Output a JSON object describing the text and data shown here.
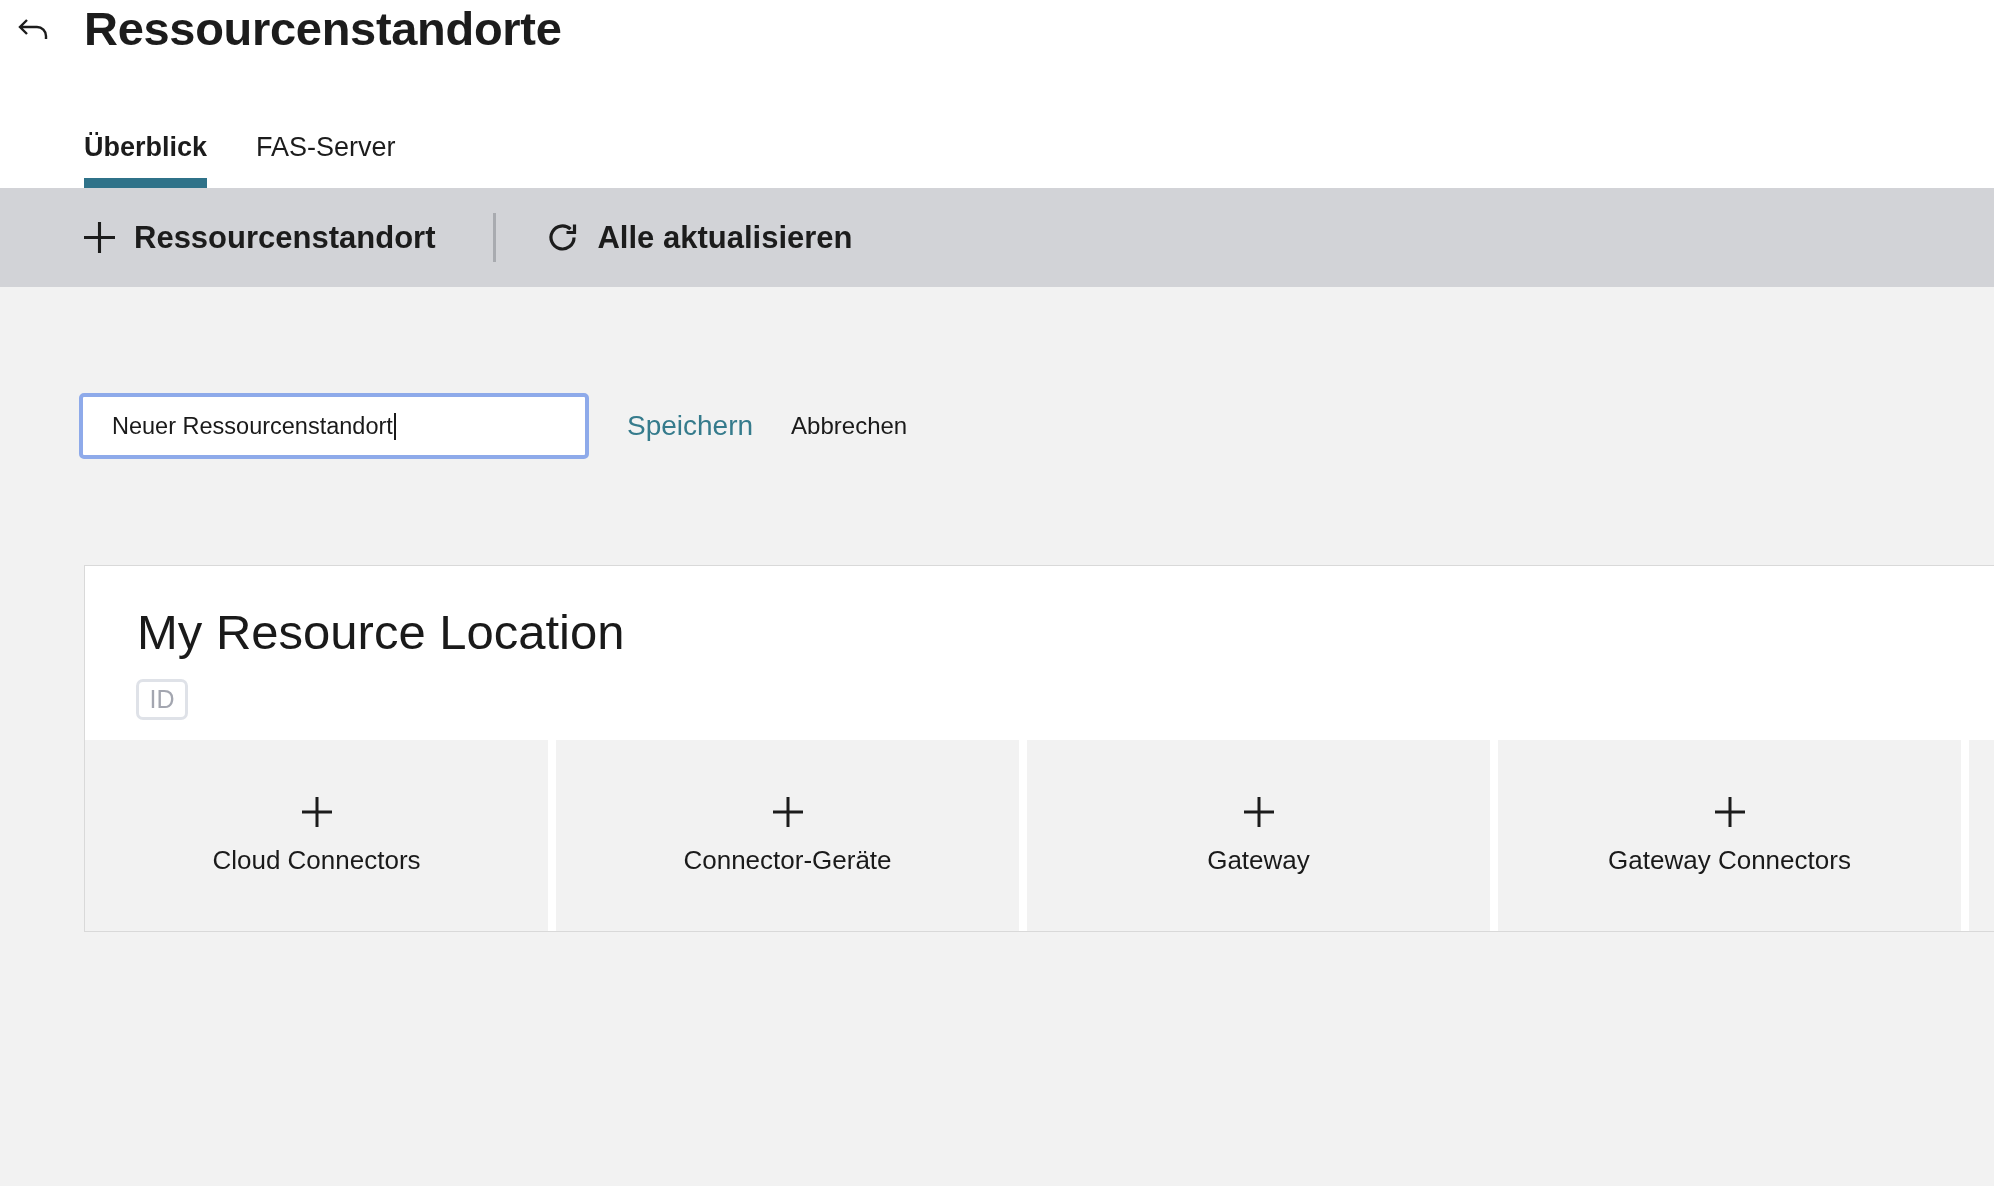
{
  "header": {
    "title": "Ressourcenstandorte"
  },
  "tabs": [
    {
      "label": "Überblick",
      "selected": true
    },
    {
      "label": "FAS-Server",
      "selected": false
    }
  ],
  "toolbar": {
    "buttons": [
      {
        "kind": "add",
        "label": "Ressourcenstandort"
      },
      {
        "kind": "refresh",
        "label": "Alle aktualisieren"
      }
    ]
  },
  "name_form": {
    "value": "Neuer Ressourcenstandort",
    "focused": true,
    "save_label": "Speichern",
    "cancel_label": "Abbrechen"
  },
  "location": {
    "title": "My Resource Location",
    "badge": "ID",
    "tiles": [
      {
        "label": "Cloud Connectors"
      },
      {
        "label": "Connector-Geräte"
      },
      {
        "label": "Gateway"
      },
      {
        "label": "Gateway Connectors"
      }
    ]
  }
}
